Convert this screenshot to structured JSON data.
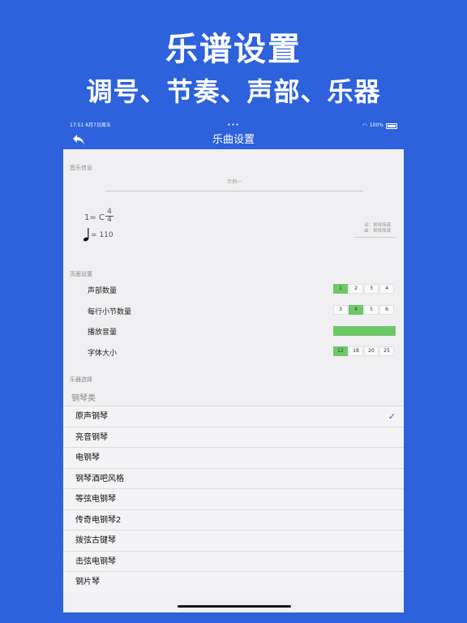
{
  "promo": {
    "title": "乐谱设置",
    "subtitle": "调号、节奏、声部、乐器"
  },
  "status_bar": {
    "time": "17:51  6月7日周五",
    "dots": "•••",
    "battery": "100%"
  },
  "nav": {
    "title": "乐曲设置"
  },
  "music_info": {
    "section_label": "音乐信息",
    "song_title": "示例一",
    "key": "1= C",
    "time_sig_top": "4",
    "time_sig_bottom": "4",
    "tempo": "= 110",
    "lyricist": "词：钢琴简谱",
    "composer": "曲：钢琴简谱"
  },
  "page_settings": {
    "section_label": "页面设置",
    "voices": {
      "label": "声部数量",
      "options": [
        "1",
        "2",
        "3",
        "4"
      ],
      "selected": "1"
    },
    "measures": {
      "label": "每行小节数量",
      "options": [
        "3",
        "4",
        "5",
        "6"
      ],
      "selected": "4"
    },
    "volume": {
      "label": "播放音量",
      "level": 1.0
    },
    "font_size": {
      "label": "字体大小",
      "options": [
        "12",
        "18",
        "20",
        "25"
      ],
      "selected": "12"
    }
  },
  "instruments": {
    "section_label": "乐器选择",
    "group": "钢琴类",
    "items": [
      "原声钢琴",
      "亮音钢琴",
      "电钢琴",
      "钢琴酒吧风格",
      "等弦电钢琴",
      "传奇电钢琴2",
      "拨弦古键琴",
      "击弦电钢琴",
      "钢片琴"
    ],
    "selected": "原声钢琴"
  },
  "colors": {
    "accent": "#2d62dc",
    "active": "#6cc868"
  }
}
